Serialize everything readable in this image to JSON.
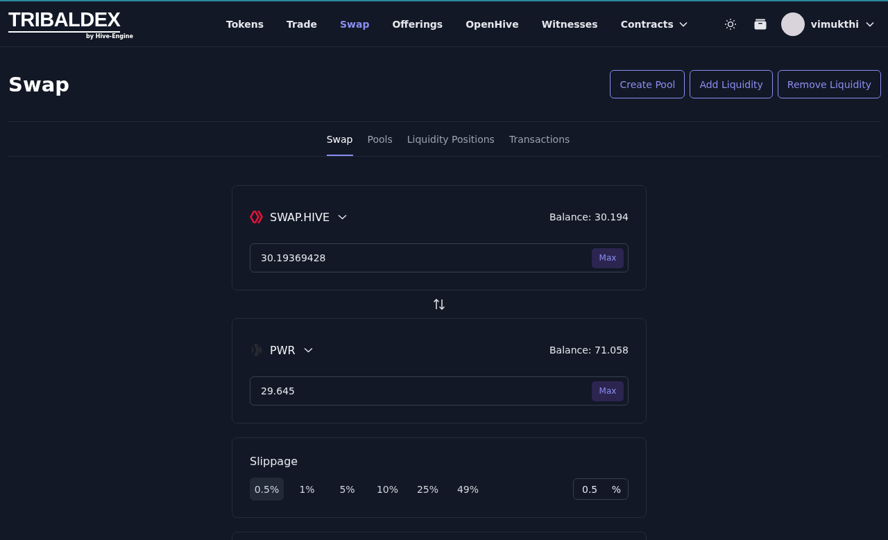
{
  "logo": {
    "name": "TRIBALDEX",
    "tagline": "by Hive-Engine"
  },
  "nav": [
    {
      "label": "Tokens",
      "selected": false,
      "dropdown": false
    },
    {
      "label": "Trade",
      "selected": false,
      "dropdown": false
    },
    {
      "label": "Swap",
      "selected": true,
      "dropdown": false
    },
    {
      "label": "Offerings",
      "selected": false,
      "dropdown": false
    },
    {
      "label": "OpenHive",
      "selected": false,
      "dropdown": false
    },
    {
      "label": "Witnesses",
      "selected": false,
      "dropdown": false
    },
    {
      "label": "Contracts",
      "selected": false,
      "dropdown": true
    }
  ],
  "user": {
    "name": "vimukthi"
  },
  "page": {
    "title": "Swap",
    "actions": [
      "Create Pool",
      "Add Liquidity",
      "Remove Liquidity"
    ]
  },
  "tabs": [
    {
      "label": "Swap",
      "selected": true
    },
    {
      "label": "Pools",
      "selected": false
    },
    {
      "label": "Liquidity Positions",
      "selected": false
    },
    {
      "label": "Transactions",
      "selected": false
    }
  ],
  "tokens": [
    {
      "symbol": "SWAP.HIVE",
      "kind": "hive",
      "balance": "Balance: 30.194",
      "amount": "30.19369428",
      "max": "Max"
    },
    {
      "symbol": "PWR",
      "kind": "pwr",
      "balance": "Balance: 71.058",
      "amount": "29.645",
      "max": "Max"
    }
  ],
  "slippage": {
    "title": "Slippage",
    "options": [
      {
        "label": "0.5%",
        "selected": true
      },
      {
        "label": "1%",
        "selected": false
      },
      {
        "label": "5%",
        "selected": false
      },
      {
        "label": "10%",
        "selected": false
      },
      {
        "label": "25%",
        "selected": false
      },
      {
        "label": "49%",
        "selected": false
      }
    ],
    "value": "0.5",
    "unit": "%"
  }
}
